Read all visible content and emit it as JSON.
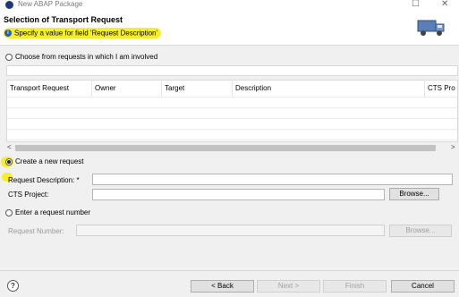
{
  "window": {
    "title": "New ABAP Package",
    "minimize": "☐",
    "close": "✕"
  },
  "header": {
    "title": "Selection of Transport Request",
    "message": "Specify a value for field 'Request Description'",
    "info_icon": "info-icon",
    "banner_icon": "transport-truck-icon"
  },
  "choose_option": {
    "label": "Choose from requests in which I am involved",
    "selected": false
  },
  "requests_table": {
    "columns": [
      "Transport Request",
      "Owner",
      "Target",
      "Description",
      "CTS Pro"
    ],
    "rows": []
  },
  "scrollbar": {
    "left": "<",
    "right": ">"
  },
  "create_option": {
    "label": "Create a new request",
    "selected": true
  },
  "form": {
    "request_description_label": "Request Description: *",
    "request_description_value": "",
    "cts_project_label": "CTS Project:",
    "cts_project_value": "",
    "browse_label": "Browse..."
  },
  "enter_option": {
    "label": "Enter a request number",
    "selected": false,
    "request_number_label": "Request Number:",
    "request_number_value": "",
    "browse_label": "Browse..."
  },
  "footer": {
    "help": "?",
    "back": "< Back",
    "next": "Next >",
    "finish": "Finish",
    "cancel": "Cancel"
  },
  "colors": {
    "highlight": "#f5ef2a",
    "body_bg": "#f0f0f0"
  }
}
